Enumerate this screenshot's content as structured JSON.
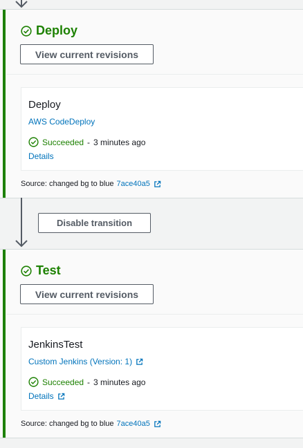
{
  "colors": {
    "success": "#1d8102",
    "link": "#0073bb",
    "button_border": "#545b64"
  },
  "stages": [
    {
      "title": "Deploy",
      "status_icon": "check-circle-icon",
      "view_revisions_label": "View current revisions",
      "action": {
        "name": "Deploy",
        "provider": "AWS CodeDeploy",
        "provider_external": false,
        "status": "Succeeded",
        "separator": "-",
        "time": "3 minutes ago",
        "details_label": "Details",
        "details_external": false
      },
      "source": {
        "text": "Source: changed bg to blue",
        "commit": "7ace40a5",
        "icon": "external-link-icon"
      }
    },
    {
      "title": "Test",
      "status_icon": "check-circle-icon",
      "view_revisions_label": "View current revisions",
      "action": {
        "name": "JenkinsTest",
        "provider": "Custom Jenkins (Version: 1)",
        "provider_external": true,
        "status": "Succeeded",
        "separator": "-",
        "time": "3 minutes ago",
        "details_label": "Details",
        "details_external": true
      },
      "source": {
        "text": "Source: changed bg to blue",
        "commit": "7ace40a5",
        "icon": "external-link-icon"
      }
    }
  ],
  "transition": {
    "button_label": "Disable transition"
  }
}
